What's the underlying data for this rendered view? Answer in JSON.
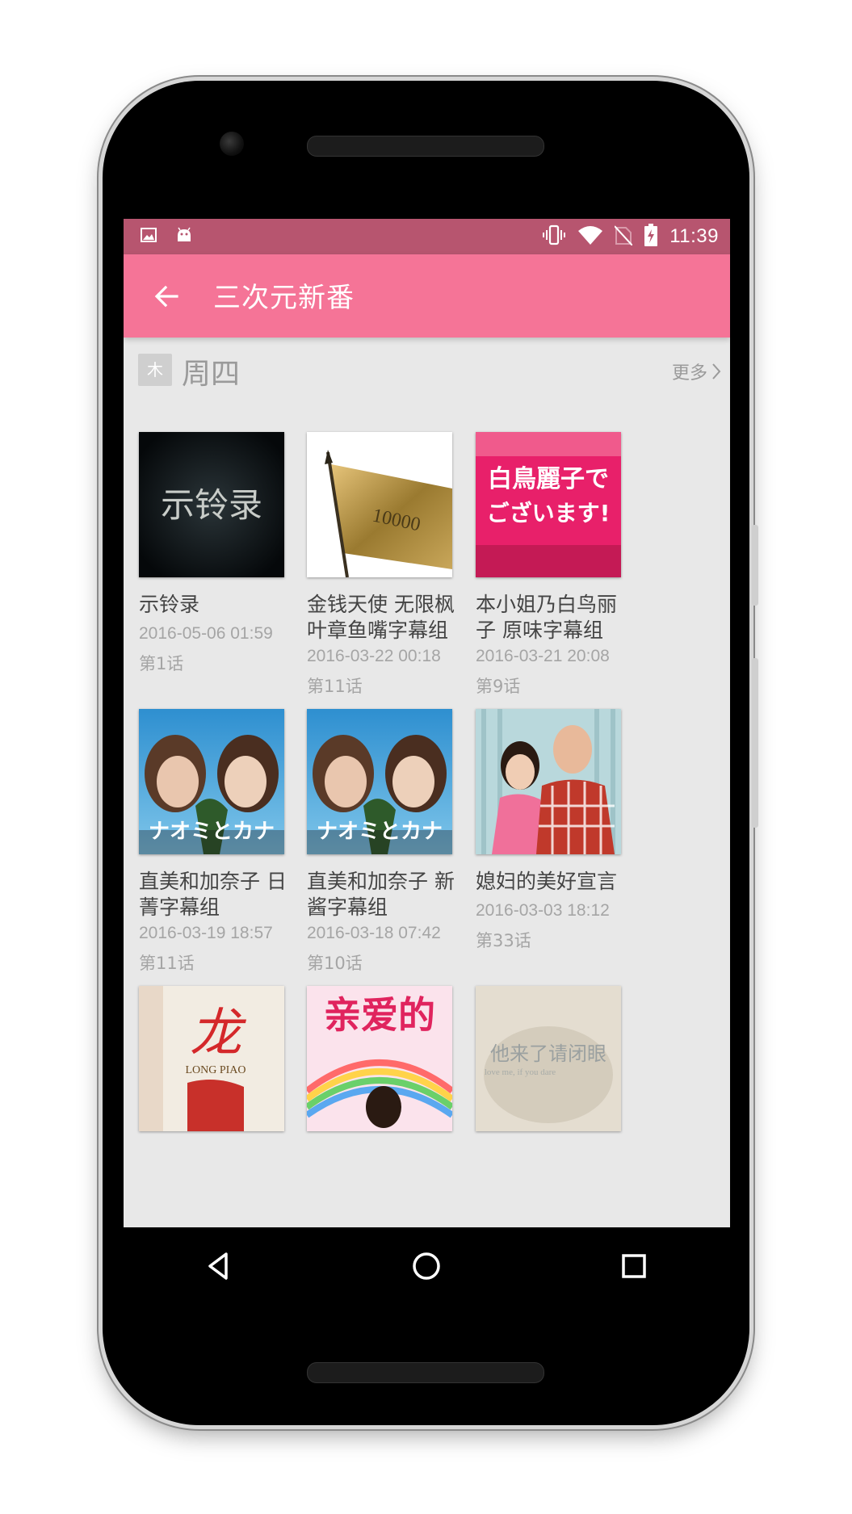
{
  "statusbar": {
    "time": "11:39",
    "left_icons": [
      "image-icon",
      "android-icon"
    ],
    "right_icons": [
      "vibrate-icon",
      "wifi-icon",
      "no-sim-icon",
      "battery-charging-icon"
    ]
  },
  "appbar": {
    "title": "三次元新番",
    "back_icon": "arrow-left-icon"
  },
  "section": {
    "badge": "木",
    "day": "周四",
    "more": "更多"
  },
  "items": [
    {
      "title": "示铃录",
      "date": "2016-05-06 01:59",
      "episode": "第1话"
    },
    {
      "title": "金钱天使 无限枫叶章鱼嘴字幕组",
      "date": "2016-03-22 00:18",
      "episode": "第11话"
    },
    {
      "title": "本小姐乃白鸟丽子 原味字幕组",
      "date": "2016-03-21 20:08",
      "episode": "第9话"
    },
    {
      "title": "直美和加奈子 日菁字幕组",
      "date": "2016-03-19 18:57",
      "episode": "第11话"
    },
    {
      "title": "直美和加奈子 新酱字幕组",
      "date": "2016-03-18 07:42",
      "episode": "第10话"
    },
    {
      "title": "媳妇的美好宣言",
      "date": "2016-03-03 18:12",
      "episode": "第33话"
    },
    {
      "title": "",
      "date": "",
      "episode": ""
    },
    {
      "title": "",
      "date": "",
      "episode": ""
    },
    {
      "title": "",
      "date": "",
      "episode": ""
    }
  ],
  "poster_text": {
    "p1": "示铃录",
    "p2_note": "10000",
    "p3_line1": "白鳥麗子で",
    "p3_line2": "ございます!",
    "p4": "ナオミとカナ",
    "p5": "ナオミとカナ",
    "p7_title": "龙",
    "p7_sub": "LONG PIAO",
    "p8": "亲爱的",
    "p9_line1": "他来了请闭眼",
    "p9_line2": "love me, if you dare"
  },
  "navbar": {
    "icons": [
      "back-triangle-icon",
      "home-circle-icon",
      "recents-square-icon"
    ]
  },
  "colors": {
    "statusbar": "#b7556f",
    "appbar": "#f57497",
    "background": "#e8e8e8"
  }
}
